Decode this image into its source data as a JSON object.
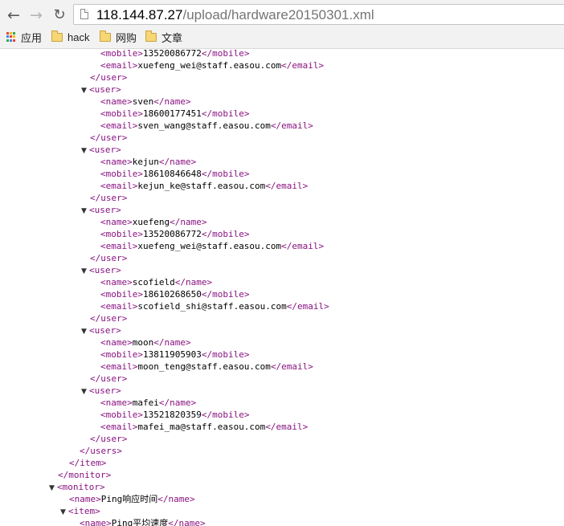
{
  "browser": {
    "nav": {
      "back_icon": "arrow-left-icon",
      "forward_icon": "arrow-right-icon",
      "reload_icon": "reload-icon"
    },
    "address": {
      "host": "118.144.87.27",
      "path": "/upload/hardware20150301.xml"
    },
    "bookmarks": [
      {
        "label": "应用",
        "icon": "apps-grid-icon"
      },
      {
        "label": "hack",
        "icon": "folder-icon"
      },
      {
        "label": "网购",
        "icon": "folder-icon"
      },
      {
        "label": "文章",
        "icon": "folder-icon"
      }
    ],
    "apps_colors": [
      "#e94235",
      "#f8bb16",
      "#34a853",
      "#4285f4",
      "#e94235",
      "#fbbc05",
      "#34a853",
      "#4285f4",
      "#ea4335"
    ]
  },
  "xml": {
    "top_partial": {
      "mobile": "13520086772",
      "email": "xuefeng_wei@staff.easou.com"
    },
    "users": [
      {
        "name": "sven",
        "mobile": "18600177451",
        "email": "sven_wang@staff.easou.com"
      },
      {
        "name": "kejun",
        "mobile": "18610846648",
        "email": "kejun_ke@staff.easou.com"
      },
      {
        "name": "xuefeng",
        "mobile": "13520086772",
        "email": "xuefeng_wei@staff.easou.com"
      },
      {
        "name": "scofield",
        "mobile": "18610268650",
        "email": "scofield_shi@staff.easou.com"
      },
      {
        "name": "moon",
        "mobile": "13811905903",
        "email": "moon_teng@staff.easou.com"
      },
      {
        "name": "mafei",
        "mobile": "13521820359",
        "email": "mafei_ma@staff.easou.com"
      }
    ],
    "monitor_name": "Ping响应时间",
    "item_name": "Ping平均速度",
    "tags": {
      "user_open": "<user>",
      "user_close": "</user>",
      "name_open": "<name>",
      "name_close": "</name>",
      "mobile_open": "<mobile>",
      "mobile_close": "</mobile>",
      "email_open": "<email>",
      "email_close": "</email>",
      "users_close": "</users>",
      "item_open": "<item>",
      "item_close": "</item>",
      "monitor_open": "<monitor>",
      "monitor_close": "</monitor>"
    },
    "toggle_glyph": "▼"
  }
}
